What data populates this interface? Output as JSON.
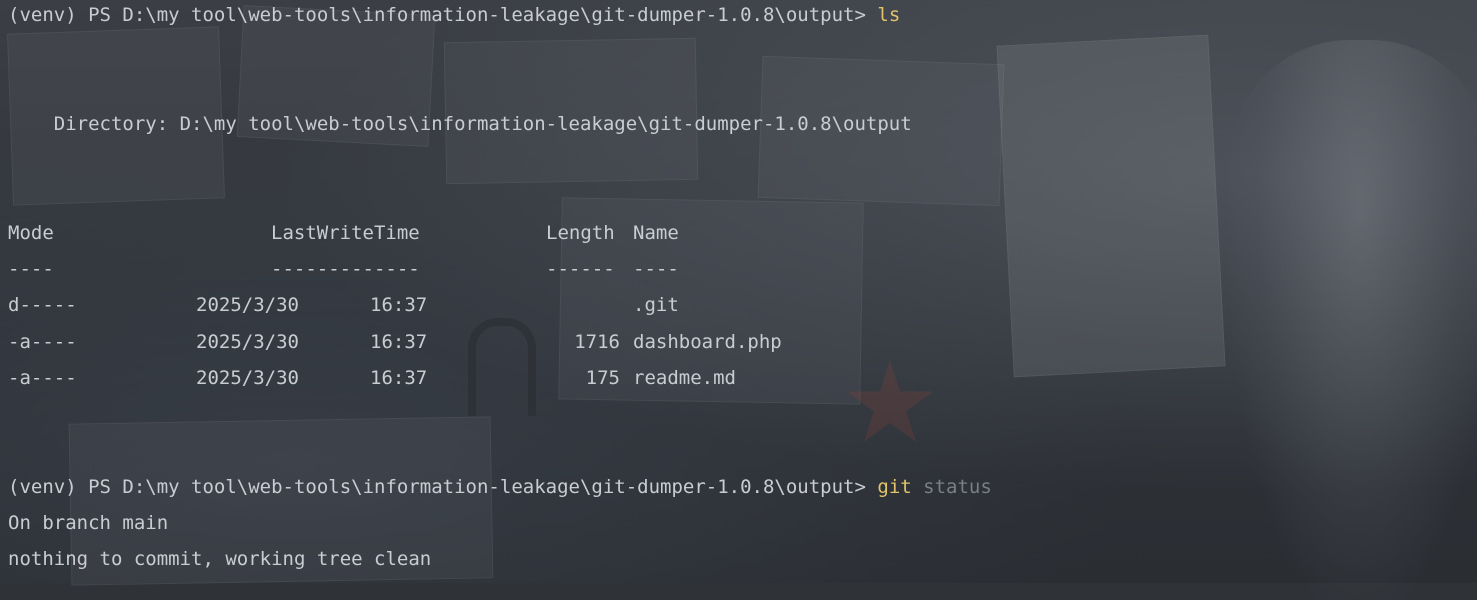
{
  "theme": {
    "text_color": "#c9cdd3",
    "command_color": "#e0c36a",
    "dim_color": "#7a7f87"
  },
  "prompt1": {
    "prefix": "(venv) PS D:\\my tool\\web-tools\\information-leakage\\git-dumper-1.0.8\\output> ",
    "command": "ls"
  },
  "directory_line": "    Directory: D:\\my tool\\web-tools\\information-leakage\\git-dumper-1.0.8\\output",
  "table": {
    "headers": {
      "mode": "Mode",
      "lastwritetime": "LastWriteTime",
      "length": "Length",
      "name": "Name"
    },
    "underlines": {
      "mode": "----",
      "lastwritetime": "-------------",
      "length": "------",
      "name": "----"
    },
    "rows": [
      {
        "mode": "d-----",
        "date": "2025/3/30",
        "time": "16:37",
        "length": "",
        "name": ".git"
      },
      {
        "mode": "-a----",
        "date": "2025/3/30",
        "time": "16:37",
        "length": "1716",
        "name": "dashboard.php"
      },
      {
        "mode": "-a----",
        "date": "2025/3/30",
        "time": "16:37",
        "length": "175",
        "name": "readme.md"
      }
    ]
  },
  "prompt2": {
    "prefix": "(venv) PS D:\\my tool\\web-tools\\information-leakage\\git-dumper-1.0.8\\output> ",
    "command": "git",
    "argument": " status"
  },
  "output": {
    "line1": "On branch main",
    "line2": "nothing to commit, working tree clean"
  },
  "background_icons": [
    "padlock-icon",
    "star-icon"
  ]
}
